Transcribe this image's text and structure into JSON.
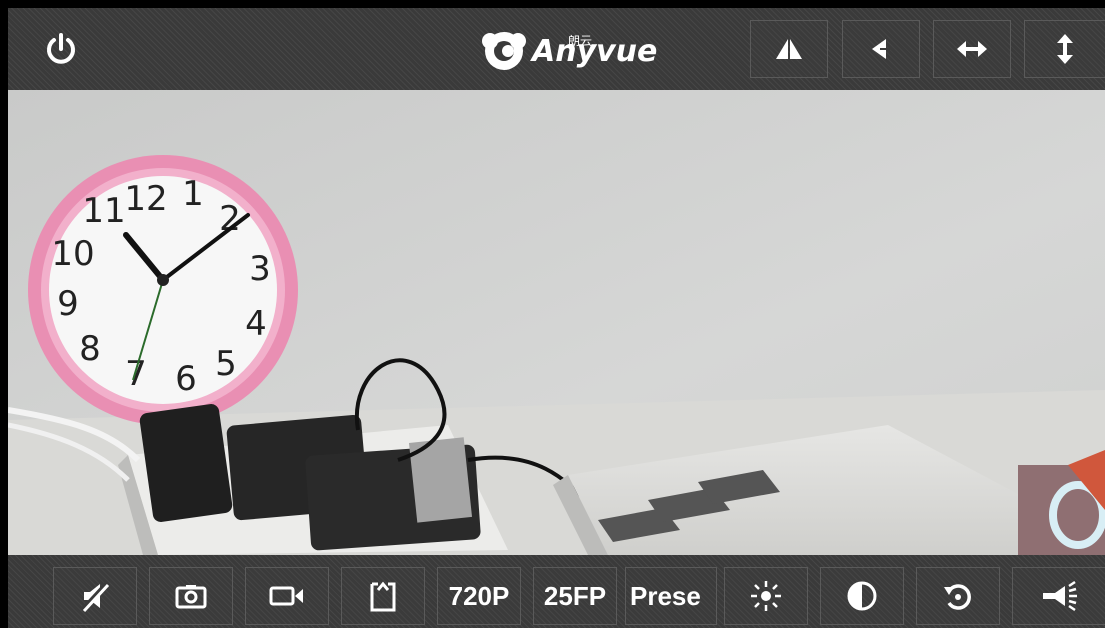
{
  "header": {
    "brand": "Anyvue",
    "brand_cn": "朗云",
    "buttons": [
      {
        "name": "flip-icon"
      },
      {
        "name": "mirror-icon"
      },
      {
        "name": "pan-horizontal-icon"
      },
      {
        "name": "pan-vertical-icon"
      }
    ]
  },
  "toolbar": {
    "resolution_label": "720P",
    "fps_label": "25FP",
    "preset_label": "Prese"
  },
  "colors": {
    "bar_bg": "#3a3a3a",
    "button_border": "#5a5a5a",
    "icon": "#ffffff"
  }
}
